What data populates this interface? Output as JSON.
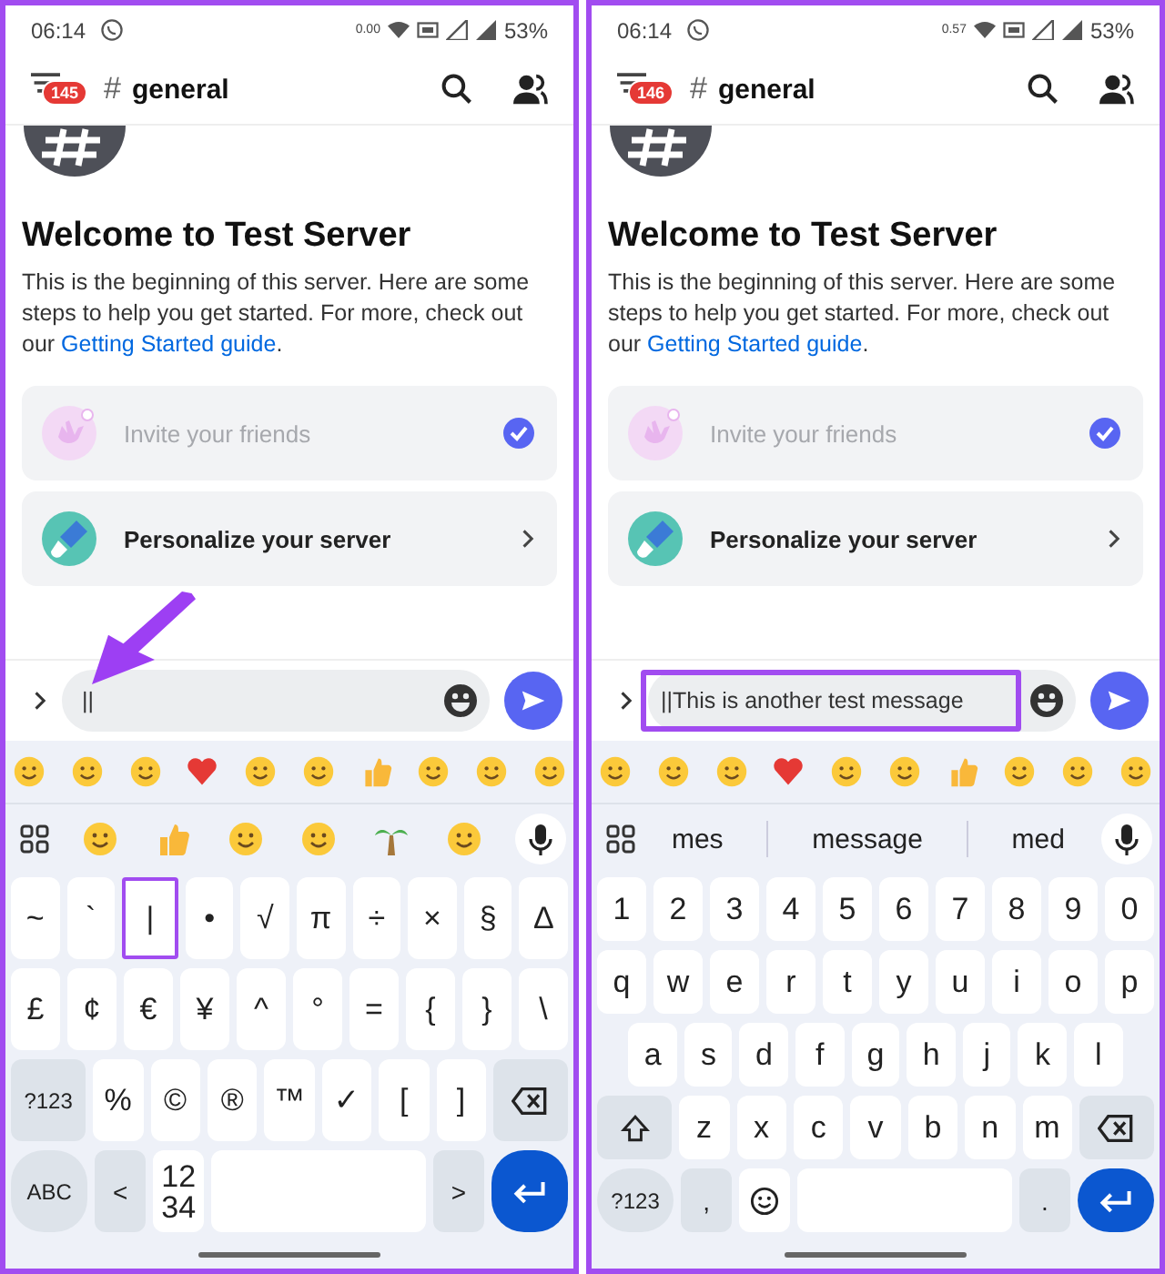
{
  "panels": [
    {
      "status": {
        "time": "06:14",
        "network_speed": "0.00",
        "battery": "53%"
      },
      "header": {
        "badge": "145",
        "hash": "#",
        "channel": "general"
      },
      "welcome": {
        "title": "Welcome to Test Server",
        "text": "This is the beginning of this server. Here are some steps to help you get started. For more, check out our ",
        "link": "Getting Started guide",
        "after": "."
      },
      "cards": [
        {
          "kind": "invite",
          "label": "Invite your friends",
          "done": true
        },
        {
          "kind": "personalize",
          "label": "Personalize your server",
          "done": false
        }
      ],
      "composer": {
        "value": "||",
        "highlighted": false
      },
      "suggestion_bar": {
        "kind": "emoji"
      },
      "key_rows": [
        [
          {
            "kind": "char",
            "label": "~"
          },
          {
            "kind": "char",
            "label": "`"
          },
          {
            "kind": "char",
            "label": "|",
            "highlighted": true
          },
          {
            "kind": "char",
            "label": "•"
          },
          {
            "kind": "char",
            "label": "√"
          },
          {
            "kind": "char",
            "label": "π"
          },
          {
            "kind": "char",
            "label": "÷"
          },
          {
            "kind": "char",
            "label": "×"
          },
          {
            "kind": "char",
            "label": "§"
          },
          {
            "kind": "char",
            "label": "Δ"
          }
        ],
        [
          {
            "kind": "char",
            "label": "£"
          },
          {
            "kind": "char",
            "label": "¢"
          },
          {
            "kind": "char",
            "label": "€"
          },
          {
            "kind": "char",
            "label": "¥"
          },
          {
            "kind": "char",
            "label": "^"
          },
          {
            "kind": "char",
            "label": "°"
          },
          {
            "kind": "char",
            "label": "="
          },
          {
            "kind": "char",
            "label": "{"
          },
          {
            "kind": "char",
            "label": "}"
          },
          {
            "kind": "char",
            "label": "\\"
          }
        ],
        [
          {
            "kind": "func",
            "label": "?123"
          },
          {
            "kind": "char",
            "label": "%"
          },
          {
            "kind": "char",
            "label": "©"
          },
          {
            "kind": "char",
            "label": "®"
          },
          {
            "kind": "char",
            "label": "™"
          },
          {
            "kind": "char",
            "label": "✓"
          },
          {
            "kind": "char",
            "label": "["
          },
          {
            "kind": "char",
            "label": "]"
          },
          {
            "kind": "backspace"
          }
        ],
        [
          {
            "kind": "round",
            "label": "ABC"
          },
          {
            "kind": "small",
            "label": "<"
          },
          {
            "kind": "char",
            "label": "12\n34"
          },
          {
            "kind": "space"
          },
          {
            "kind": "small",
            "label": ">"
          },
          {
            "kind": "enter"
          }
        ]
      ],
      "annotation_arrow": true
    },
    {
      "status": {
        "time": "06:14",
        "network_speed": "0.57",
        "battery": "53%"
      },
      "header": {
        "badge": "146",
        "hash": "#",
        "channel": "general"
      },
      "welcome": {
        "title": "Welcome to Test Server",
        "text": "This is the beginning of this server. Here are some steps to help you get started. For more, check out our ",
        "link": "Getting Started guide",
        "after": "."
      },
      "cards": [
        {
          "kind": "invite",
          "label": "Invite your friends",
          "done": true
        },
        {
          "kind": "personalize",
          "label": "Personalize your server",
          "done": false
        }
      ],
      "composer": {
        "value": "||This is another test message",
        "highlighted": true
      },
      "suggestion_bar": {
        "kind": "words",
        "words": [
          "mes",
          "message",
          "med"
        ]
      },
      "key_rows": [
        [
          {
            "kind": "char",
            "label": "1"
          },
          {
            "kind": "char",
            "label": "2"
          },
          {
            "kind": "char",
            "label": "3"
          },
          {
            "kind": "char",
            "label": "4"
          },
          {
            "kind": "char",
            "label": "5"
          },
          {
            "kind": "char",
            "label": "6"
          },
          {
            "kind": "char",
            "label": "7"
          },
          {
            "kind": "char",
            "label": "8"
          },
          {
            "kind": "char",
            "label": "9"
          },
          {
            "kind": "char",
            "label": "0"
          }
        ],
        [
          {
            "kind": "char",
            "label": "q"
          },
          {
            "kind": "char",
            "label": "w"
          },
          {
            "kind": "char",
            "label": "e"
          },
          {
            "kind": "char",
            "label": "r"
          },
          {
            "kind": "char",
            "label": "t"
          },
          {
            "kind": "char",
            "label": "y"
          },
          {
            "kind": "char",
            "label": "u"
          },
          {
            "kind": "char",
            "label": "i"
          },
          {
            "kind": "char",
            "label": "o"
          },
          {
            "kind": "char",
            "label": "p"
          }
        ],
        [
          {
            "kind": "indent"
          },
          {
            "kind": "char",
            "label": "a"
          },
          {
            "kind": "char",
            "label": "s"
          },
          {
            "kind": "char",
            "label": "d"
          },
          {
            "kind": "char",
            "label": "f"
          },
          {
            "kind": "char",
            "label": "g"
          },
          {
            "kind": "char",
            "label": "h"
          },
          {
            "kind": "char",
            "label": "j"
          },
          {
            "kind": "char",
            "label": "k"
          },
          {
            "kind": "char",
            "label": "l"
          },
          {
            "kind": "indent"
          }
        ],
        [
          {
            "kind": "shift"
          },
          {
            "kind": "char",
            "label": "z"
          },
          {
            "kind": "char",
            "label": "x"
          },
          {
            "kind": "char",
            "label": "c"
          },
          {
            "kind": "char",
            "label": "v"
          },
          {
            "kind": "char",
            "label": "b"
          },
          {
            "kind": "char",
            "label": "n"
          },
          {
            "kind": "char",
            "label": "m"
          },
          {
            "kind": "backspace"
          }
        ],
        [
          {
            "kind": "round",
            "label": "?123"
          },
          {
            "kind": "small",
            "label": ","
          },
          {
            "kind": "emoji"
          },
          {
            "kind": "space"
          },
          {
            "kind": "small",
            "label": "."
          },
          {
            "kind": "enter"
          }
        ]
      ]
    }
  ]
}
